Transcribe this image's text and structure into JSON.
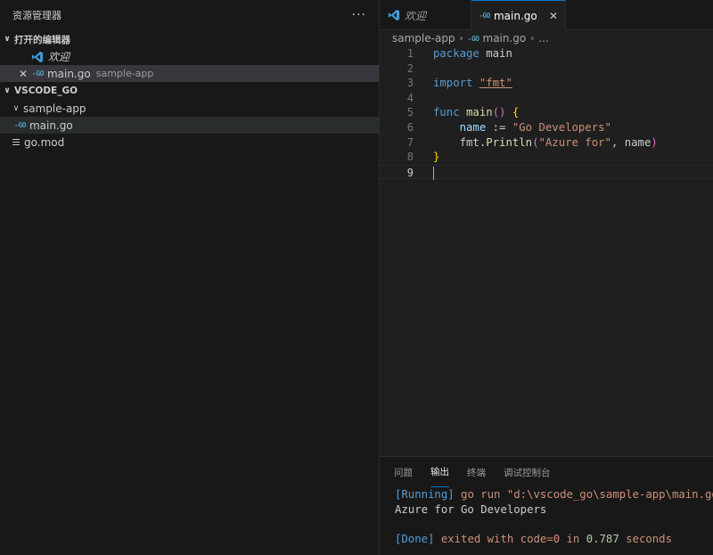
{
  "sidebar": {
    "title": "资源管理器",
    "more": "···",
    "open_editors": {
      "label": "打开的编辑器",
      "items": [
        {
          "name": "欢迎",
          "desc": ""
        },
        {
          "name": "main.go",
          "desc": "sample-app"
        }
      ]
    },
    "workspace": {
      "label": "VSCODE_GO",
      "folder": "sample-app",
      "files": [
        "main.go",
        "go.mod"
      ]
    }
  },
  "tabs": [
    {
      "label": "欢迎",
      "active": false
    },
    {
      "label": "main.go",
      "active": true
    }
  ],
  "breadcrumb": {
    "folder": "sample-app",
    "file": "main.go",
    "more": "..."
  },
  "code": {
    "line_numbers": [
      "1",
      "2",
      "3",
      "4",
      "5",
      "6",
      "7",
      "8",
      "9"
    ],
    "l1_kw": "package",
    "l1_rest": " main",
    "l3_kw": "import",
    "l3_str": "\"fmt\"",
    "l5_kw": "func",
    "l5_fn": "main",
    "l5_paren": "()",
    "l5_brace": "{",
    "l6_var": "name",
    "l6_op": " := ",
    "l6_str": "\"Go Developers\"",
    "l7_pkg": "fmt",
    "l7_dot": ".",
    "l7_fn": "Println",
    "l7_open": "(",
    "l7_str": "\"Azure for\"",
    "l7_sep": ", ",
    "l7_var": "name",
    "l7_close": ")",
    "l8_brace": "}"
  },
  "panel": {
    "tabs": [
      "问题",
      "输出",
      "终端",
      "调试控制台"
    ],
    "active_tab": "输出",
    "out1_tag": "[Running]",
    "out1_cmd": " go run \"d:\\vscode_go\\sample-app\\main.go\"",
    "out2": "Azure for Go Developers",
    "out4_tag": "[Done]",
    "out4_a": " exited with ",
    "out4_code": "code=0",
    "out4_b": " in ",
    "out4_num": "0.787",
    "out4_c": " seconds"
  },
  "colors": {
    "accent": "#0078d4",
    "vscode_blue": "#3e9bd9",
    "go_icon": "#519aba"
  }
}
